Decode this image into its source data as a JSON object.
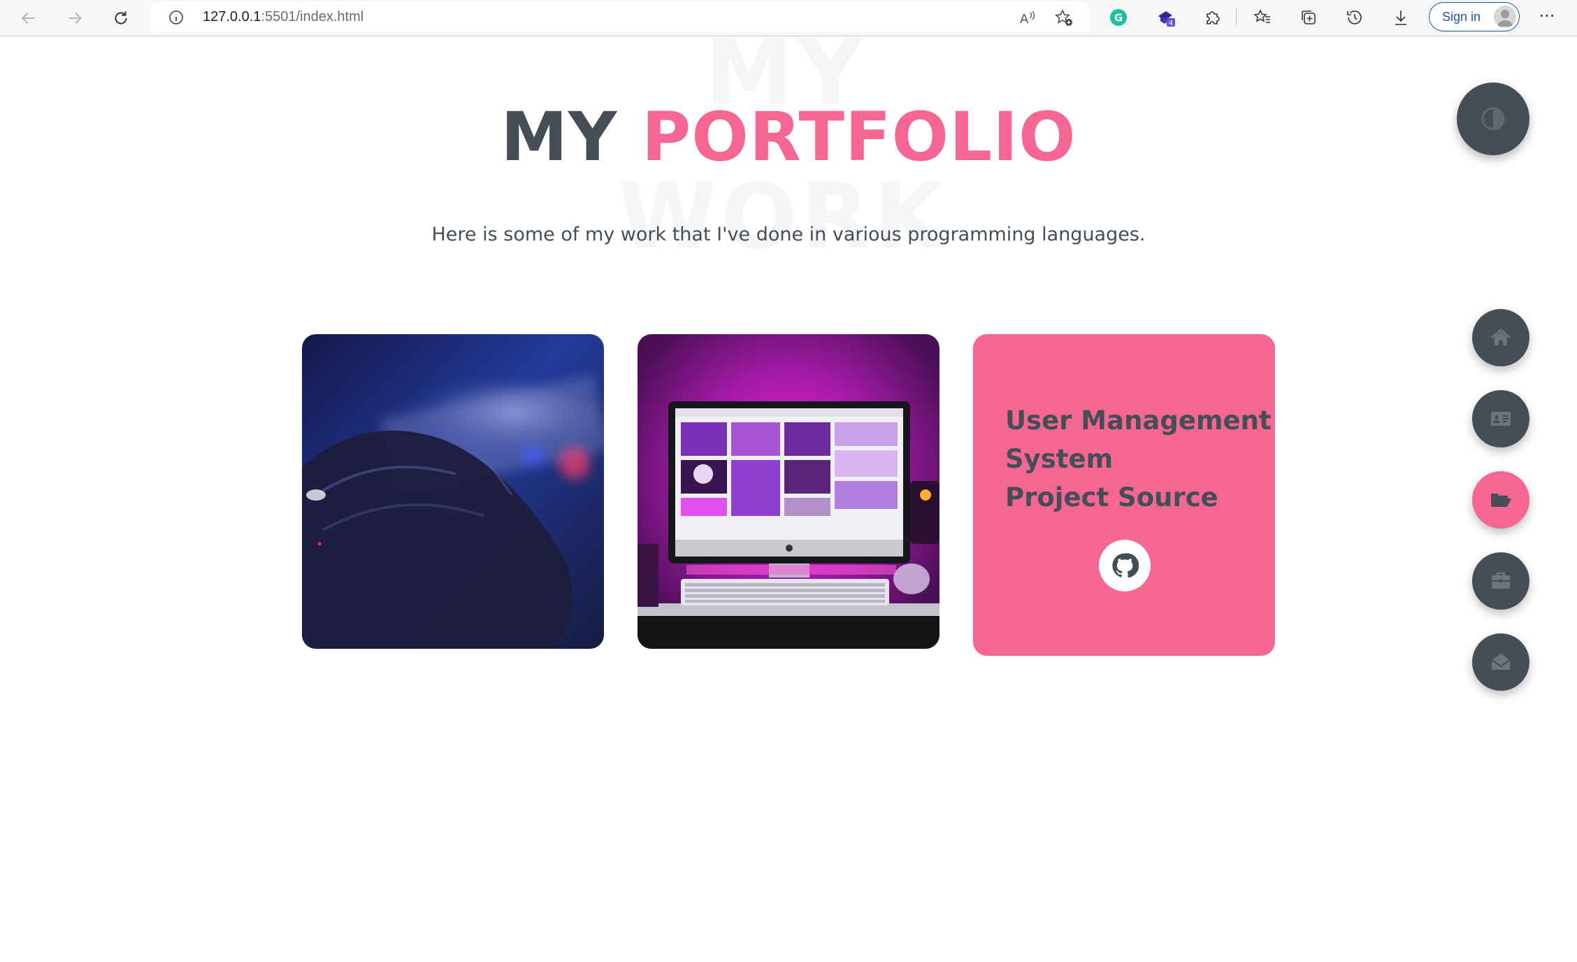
{
  "browser": {
    "url_host": "127.0.0.1",
    "url_path": ":5501/index.html",
    "extension_badge": "4",
    "signin_label": "Sign in",
    "more_label": "···",
    "icons": [
      "back-arrow-icon",
      "forward-arrow-icon",
      "reload-icon",
      "info-icon",
      "read-aloud-icon",
      "add-favorite-icon",
      "grammarly-icon",
      "extension-icon",
      "puzzle-icon",
      "favorites-icon",
      "collections-icon",
      "history-icon",
      "download-icon",
      "profile-icon",
      "more-icon"
    ]
  },
  "page": {
    "bg_word_1": "MY",
    "bg_word_2": "WORK",
    "title_main": "MY",
    "title_accent": "PORTFOLIO",
    "subtitle": "Here is some of my work that I've done in various programming languages.",
    "accent_color": "#f56692",
    "text_color": "#454e56"
  },
  "portfolio": {
    "items": [
      {
        "image": "hand-on-keyboard-photo"
      },
      {
        "image": "imac-desk-pink-light-photo"
      },
      {
        "title_lines": [
          "User Management",
          "System",
          "Project Source"
        ],
        "link_icon": "github-icon"
      }
    ]
  },
  "floating": {
    "theme_toggle_icon": "contrast-icon",
    "nav_icons": [
      "home-icon",
      "id-card-icon",
      "folder-open-icon",
      "briefcase-icon",
      "envelope-open-icon"
    ],
    "active_index": 2
  }
}
